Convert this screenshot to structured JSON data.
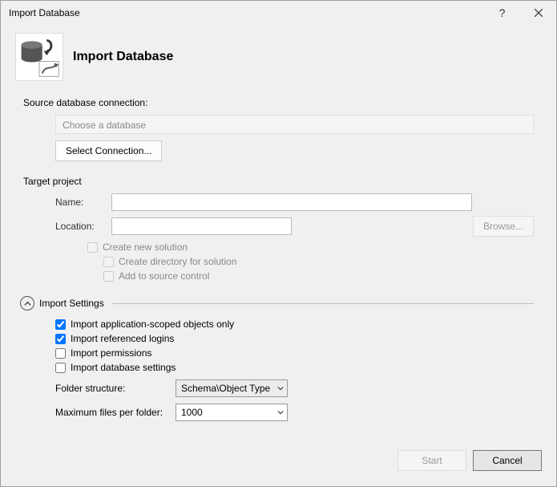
{
  "window": {
    "title": "Import Database",
    "help": "?",
    "close": "×"
  },
  "header": {
    "title": "Import Database"
  },
  "source": {
    "label": "Source database connection:",
    "placeholder": "Choose a database",
    "select_button": "Select Connection..."
  },
  "target": {
    "section_label": "Target project",
    "name_label": "Name:",
    "name_value": "",
    "location_label": "Location:",
    "location_value": "",
    "browse_button": "Browse...",
    "create_solution": "Create new solution",
    "create_directory": "Create directory for solution",
    "add_source_control": "Add to source control"
  },
  "settings": {
    "title": "Import Settings",
    "import_app_scoped": "Import application-scoped objects only",
    "import_ref_logins": "Import referenced logins",
    "import_permissions": "Import permissions",
    "import_db_settings": "Import database settings",
    "folder_structure_label": "Folder structure:",
    "folder_structure_value": "Schema\\Object Type",
    "max_files_label": "Maximum files per folder:",
    "max_files_value": "1000"
  },
  "footer": {
    "start": "Start",
    "cancel": "Cancel"
  }
}
